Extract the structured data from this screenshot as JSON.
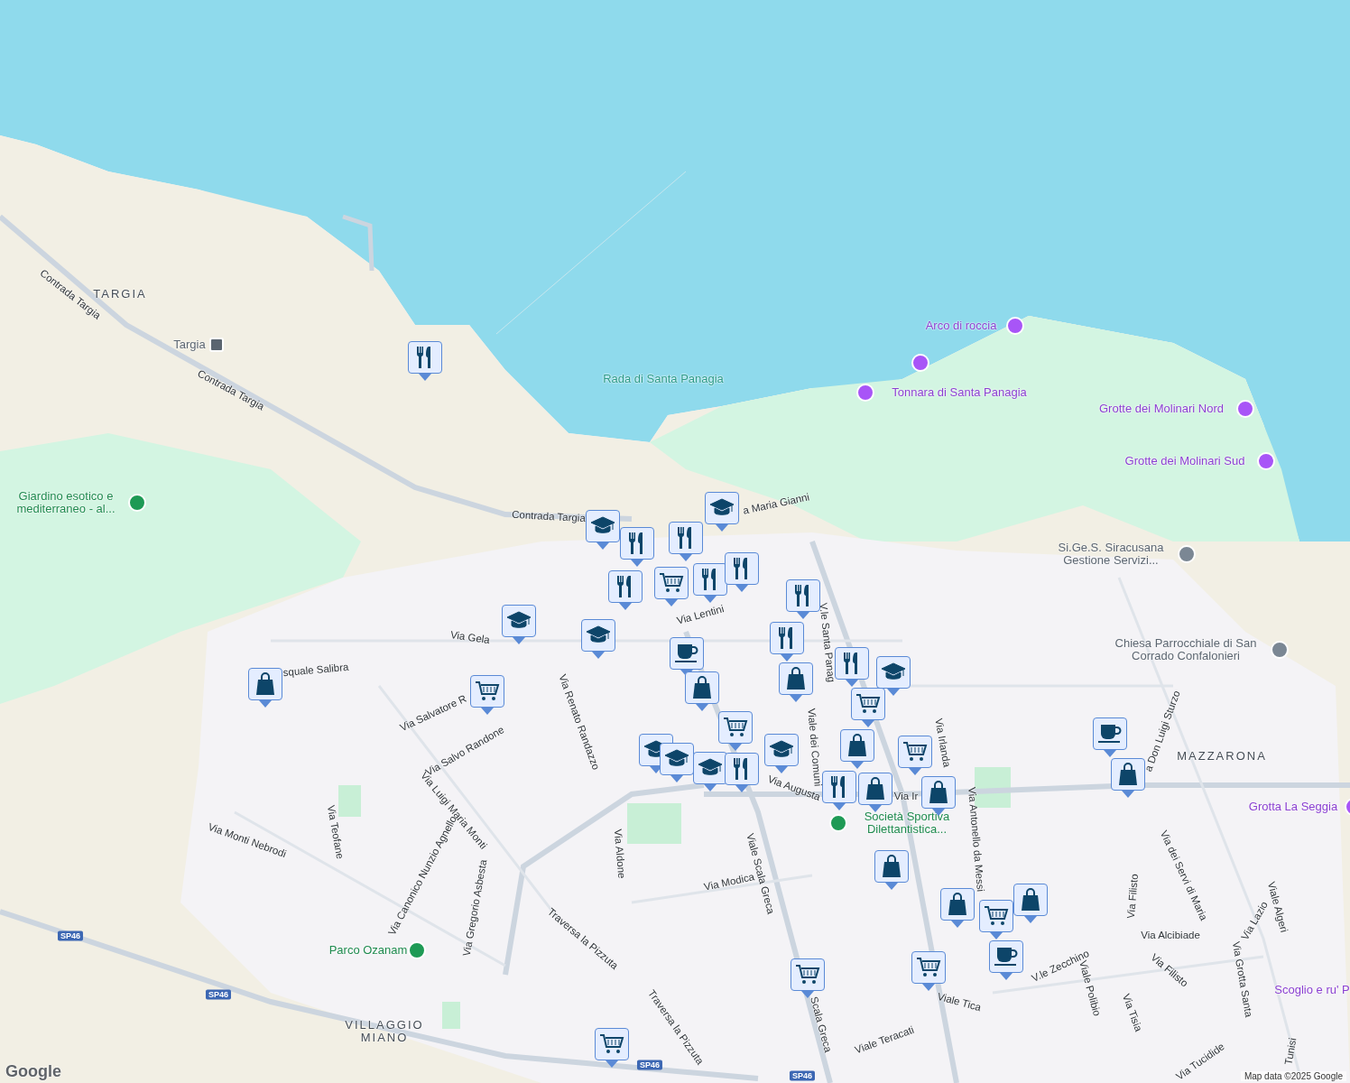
{
  "map": {
    "labels": [
      {
        "text": "TARGIA",
        "kind": "area"
      },
      {
        "text": "Contrada Targia",
        "kind": "street"
      },
      {
        "text": "Targia",
        "kind": "station"
      },
      {
        "text": "Arco di roccia",
        "kind": "attraction"
      },
      {
        "kind": "attraction"
      },
      {
        "text": "Rada di Santa Panagia",
        "kind": "water"
      },
      {
        "text": "Contrada Targia",
        "kind": "street"
      },
      {
        "text": "Tonnara di Santa Panagia",
        "kind": "attraction"
      },
      {
        "text": "Grotte dei Molinari Nord",
        "kind": "attraction"
      },
      {
        "text": "Grotte dei Molinari Sud",
        "kind": "attraction"
      },
      {
        "text": "Giardino esotico e mediterraneo - al...",
        "kind": "park"
      },
      {
        "text": "a Maria Gianni",
        "kind": "street"
      },
      {
        "text": "Contrada Targia",
        "kind": "street"
      },
      {
        "text": "Si.Ge.S. Siracusana Gestione Servizi...",
        "kind": "place"
      },
      {
        "text": "Via Lentini",
        "kind": "street"
      },
      {
        "text": "V.le Santa Panag",
        "kind": "street"
      },
      {
        "text": "Via Gela",
        "kind": "street"
      },
      {
        "text": "Chiesa Parrocchiale di San Corrado Confalonieri",
        "kind": "church"
      },
      {
        "text": "squale Salibra",
        "kind": "street"
      },
      {
        "text": "Via Salvatore R",
        "kind": "street"
      },
      {
        "text": "Via Renato Randazzo",
        "kind": "street"
      },
      {
        "text": "a Don Luigi Sturzo",
        "kind": "street"
      },
      {
        "text": "Via Salvo Randone",
        "kind": "street"
      },
      {
        "text": "Viale dei Comuni",
        "kind": "street"
      },
      {
        "text": "Via Irlanda",
        "kind": "street"
      },
      {
        "text": "MAZZARONA",
        "kind": "area"
      },
      {
        "text": "Via Augusta",
        "kind": "street"
      },
      {
        "text": "Via Ir",
        "kind": "street"
      },
      {
        "text": "Via Luigi Maria Monti",
        "kind": "street"
      },
      {
        "text": "Grotta La Seggia",
        "kind": "attraction"
      },
      {
        "text": "Società Sportiva Dilettantistica...",
        "kind": "sport"
      },
      {
        "text": "Via Antonello da Messi",
        "kind": "street"
      },
      {
        "text": "Via Monti Nebrodi",
        "kind": "street"
      },
      {
        "text": "Via Teofane",
        "kind": "street"
      },
      {
        "text": "Via Aldone",
        "kind": "street"
      },
      {
        "text": "Viale Scala Greca",
        "kind": "street"
      },
      {
        "text": "Via Canonico Nunzio Agnello",
        "kind": "street"
      },
      {
        "text": "Via dei Servi di Maria",
        "kind": "street"
      },
      {
        "text": "Via Modica",
        "kind": "street"
      },
      {
        "text": "Via Filisto",
        "kind": "street"
      },
      {
        "text": "Viale Algeri",
        "kind": "street"
      },
      {
        "text": "Via Gregorio Asbesta",
        "kind": "street"
      },
      {
        "text": "Via Lazio",
        "kind": "street"
      },
      {
        "text": "Via Alcibiade",
        "kind": "street"
      },
      {
        "text": "Traversa la Pizzuta",
        "kind": "street"
      },
      {
        "text": "SP46",
        "kind": "shield"
      },
      {
        "text": "Parco Ozanam",
        "kind": "park"
      },
      {
        "text": "V.le Zecchino",
        "kind": "street"
      },
      {
        "text": "Via Filisto",
        "kind": "street"
      },
      {
        "text": "Via Grotta Santa",
        "kind": "street"
      },
      {
        "text": "Viale Polibio",
        "kind": "street"
      },
      {
        "text": "Scoglio e ru' P",
        "kind": "attraction"
      },
      {
        "text": "SP46",
        "kind": "shield"
      },
      {
        "text": "Viale Tica",
        "kind": "street"
      },
      {
        "text": "Scala Greca",
        "kind": "street"
      },
      {
        "text": "Via Tisia",
        "kind": "street"
      },
      {
        "text": "Traversa la Pizzuta",
        "kind": "street"
      },
      {
        "text": "VILLAGGIO MIANO",
        "kind": "area"
      },
      {
        "text": "Viale Teracati",
        "kind": "street"
      },
      {
        "text": "Tunisi",
        "kind": "street"
      },
      {
        "text": "SP46",
        "kind": "shield"
      },
      {
        "text": "SP46",
        "kind": "shield"
      },
      {
        "text": "Via Tucidide",
        "kind": "street"
      }
    ],
    "markers": [
      {
        "kind": "restaurant"
      },
      {
        "kind": "school"
      },
      {
        "kind": "school"
      },
      {
        "kind": "restaurant"
      },
      {
        "kind": "restaurant"
      },
      {
        "kind": "restaurant"
      },
      {
        "kind": "cart"
      },
      {
        "kind": "restaurant"
      },
      {
        "kind": "restaurant"
      },
      {
        "kind": "restaurant"
      },
      {
        "kind": "school"
      },
      {
        "kind": "school"
      },
      {
        "kind": "restaurant"
      },
      {
        "kind": "coffee"
      },
      {
        "kind": "bag"
      },
      {
        "kind": "school"
      },
      {
        "kind": "restaurant"
      },
      {
        "kind": "bag"
      },
      {
        "kind": "bag"
      },
      {
        "kind": "cart"
      },
      {
        "kind": "cart"
      },
      {
        "kind": "coffee"
      },
      {
        "kind": "cart"
      },
      {
        "kind": "bag"
      },
      {
        "kind": "school"
      },
      {
        "kind": "cart"
      },
      {
        "kind": "school"
      },
      {
        "kind": "restaurant"
      },
      {
        "kind": "school"
      },
      {
        "kind": "school"
      },
      {
        "kind": "bag"
      },
      {
        "kind": "restaurant"
      },
      {
        "kind": "bag"
      },
      {
        "kind": "bag"
      },
      {
        "kind": "bag"
      },
      {
        "kind": "bag"
      },
      {
        "kind": "bag"
      },
      {
        "kind": "cart"
      },
      {
        "kind": "coffee"
      },
      {
        "kind": "cart"
      },
      {
        "kind": "cart"
      },
      {
        "kind": "cart"
      }
    ],
    "attribution": "Map data ©2025 Google",
    "logo": "Google"
  }
}
